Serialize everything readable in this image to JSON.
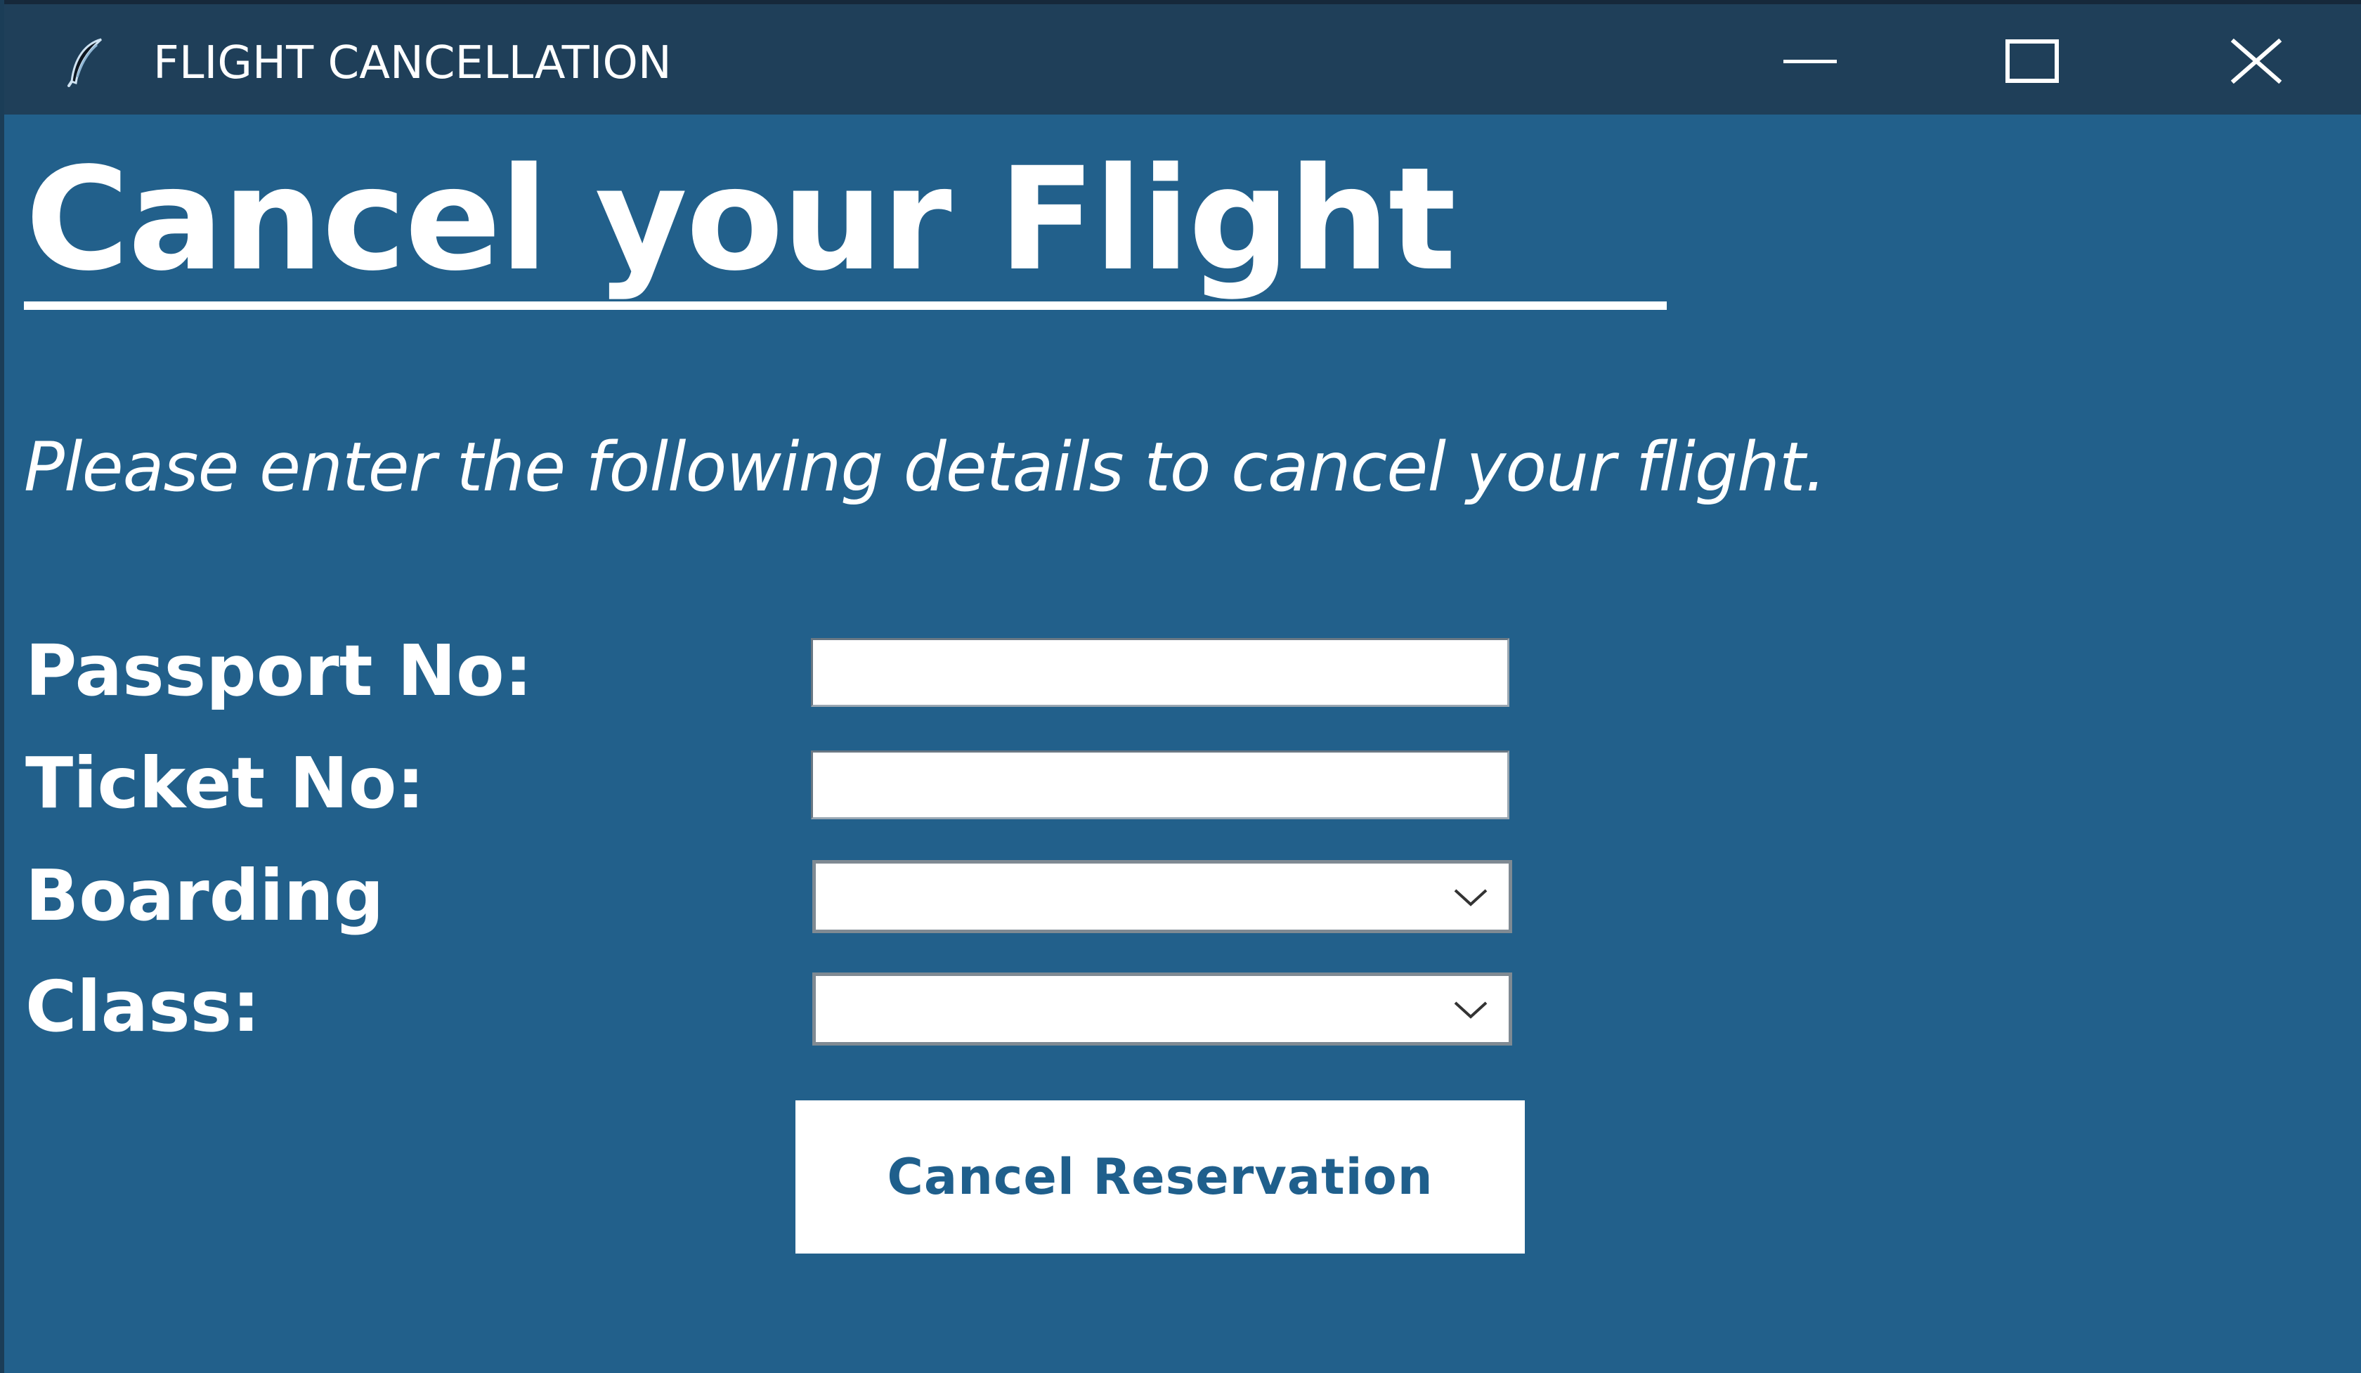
{
  "window": {
    "title": "FLIGHT CANCELLATION",
    "app_icon": "feather-icon",
    "controls": {
      "minimize_icon": "minimize-icon",
      "maximize_icon": "maximize-icon",
      "close_icon": "close-icon"
    }
  },
  "form": {
    "heading": "Cancel your Flight",
    "instructions": "Please enter the following details to cancel your flight.",
    "fields": {
      "passport": {
        "label": "Passport No:",
        "value": ""
      },
      "ticket": {
        "label": "Ticket No:",
        "value": ""
      },
      "boarding": {
        "label": "Boarding",
        "value": ""
      },
      "class": {
        "label": "Class:",
        "value": ""
      }
    },
    "submit_label": "Cancel Reservation"
  },
  "colors": {
    "background": "#22608b",
    "titlebar": "#1f3f59",
    "text": "#ffffff",
    "button_text": "#1f5f8c"
  }
}
